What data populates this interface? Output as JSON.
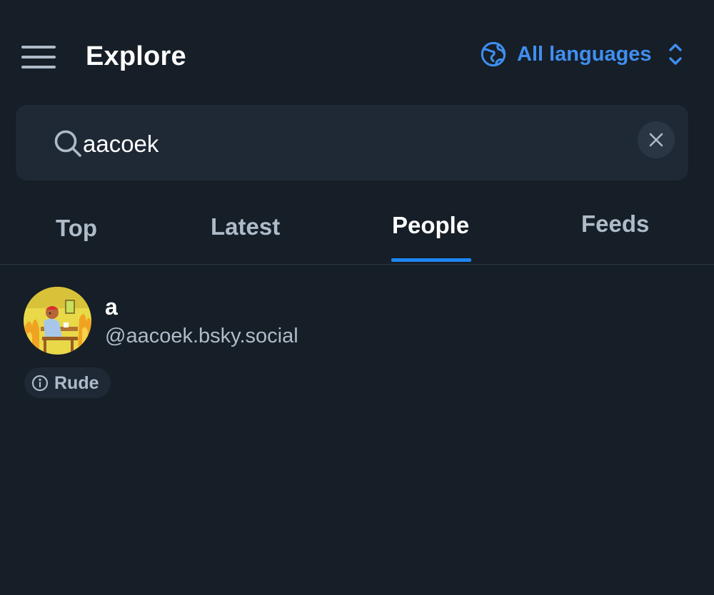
{
  "colors": {
    "background": "#161e27",
    "surface": "#1e2935",
    "accent": "#1e86f2",
    "link": "#3f8ff0",
    "muted_text": "#aebbc9",
    "primary_text": "#ffffff"
  },
  "header": {
    "menu_icon": "hamburger-menu-icon",
    "title": "Explore",
    "language_selector": {
      "icon": "globe-icon",
      "label": "All languages",
      "chevron_icon": "chevron-up-down-icon"
    }
  },
  "search": {
    "icon": "search-icon",
    "value": "aacoek",
    "placeholder": "",
    "clear_icon": "close-icon"
  },
  "tabs": [
    {
      "label": "Top",
      "active": false
    },
    {
      "label": "Latest",
      "active": false
    },
    {
      "label": "People",
      "active": true
    },
    {
      "label": "Feeds",
      "active": false
    }
  ],
  "results": [
    {
      "display_name": "a",
      "handle": "@aacoek.bsky.social",
      "label": {
        "icon": "info-icon",
        "text": "Rude"
      }
    }
  ]
}
